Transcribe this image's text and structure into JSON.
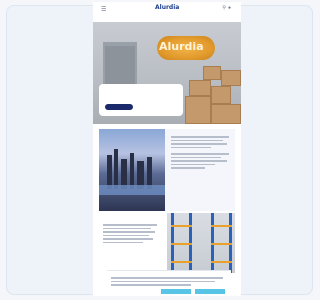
{
  "header": {
    "menu_icon": "hamburger-icon",
    "logo": "Alurdia",
    "icons": [
      "search-icon",
      "globe-icon"
    ],
    "nav": [
      "",
      "",
      "",
      "",
      ""
    ]
  },
  "hero": {
    "sign_text": "Alurdia",
    "title": "",
    "button_label": ""
  },
  "city_section": {
    "heading": "",
    "body": ""
  },
  "warehouse_section": {
    "heading": ""
  },
  "cookie_banner": {
    "title": "",
    "reject_label": "",
    "settings_label": "",
    "accept_label": ""
  },
  "colors": {
    "brand_navy": "#1a2a6a",
    "brand_orange": "#e29a2c",
    "accent_cyan": "#58c4e6",
    "rack_blue": "#2c61b8"
  }
}
